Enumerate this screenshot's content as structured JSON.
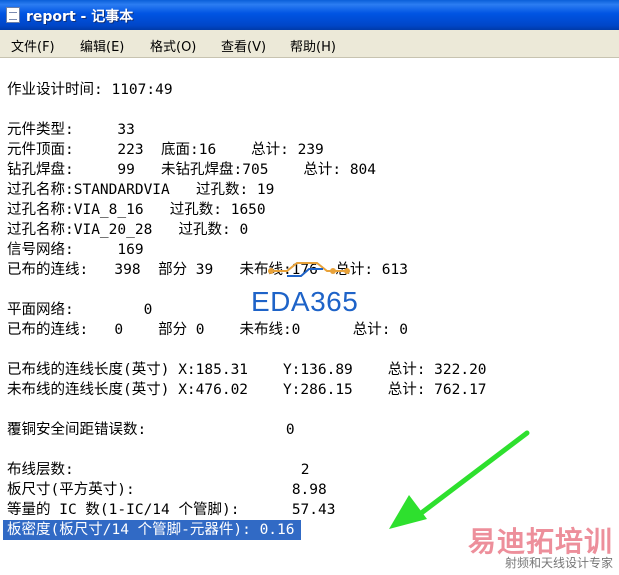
{
  "window": {
    "title": "report - 记事本"
  },
  "menu": [
    {
      "label": "文件(F)"
    },
    {
      "label": "编辑(E)"
    },
    {
      "label": "格式(O)"
    },
    {
      "label": "查看(V)"
    },
    {
      "label": "帮助(H)"
    }
  ],
  "report_lines": [
    "作业设计时间: 1107:49",
    "元件类型:     33",
    "元件顶面:     223  底面:16    总计: 239",
    "钻孔焊盘:     99   未钻孔焊盘:705    总计: 804",
    "过孔名称:STANDARDVIA   过孔数: 19",
    "过孔名称:VIA_8_16   过孔数: 1650",
    "过孔名称:VIA_20_28   过孔数: 0",
    "信号网络:     169",
    "已布的连线:   398  部分 39   未布线:176  总计: 613",
    "平面网络:        0",
    "已布的连线:   0    部分 0    未布线:0      总计: 0",
    "已布线的连线长度(英寸) X:185.31    Y:136.89    总计: 322.20",
    "未布线的连线长度(英寸) X:476.02    Y:286.15    总计: 762.17",
    "覆铜安全间距错误数:                0",
    "布线层数:                          2",
    "板尺寸(平方英寸):                  8.98",
    "等量的 IC 数(1-IC/14 个管脚):      57.43",
    "板密度(板尺寸/14 个管脚-元器件): 0.16"
  ],
  "watermarks": {
    "center": "EDA365",
    "corner_main": "易迪拓培训",
    "corner_sub": "射频和天线设计专家"
  },
  "colors": {
    "selection": "#316ac5",
    "arrow": "#2ee02e",
    "titlebar": "#0054e3"
  },
  "icons": [
    "notepad-app-icon",
    "arrow-annotation-icon"
  ]
}
